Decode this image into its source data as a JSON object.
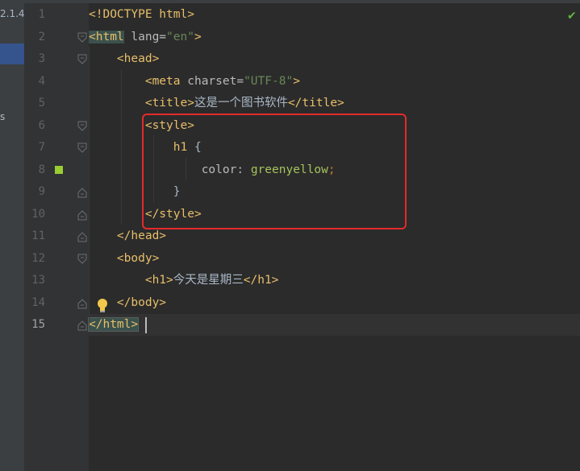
{
  "sidebar": {
    "version_text": "2.1.4",
    "mark_text": "s"
  },
  "gutter": {
    "line_numbers": [
      "1",
      "2",
      "3",
      "4",
      "5",
      "6",
      "7",
      "8",
      "9",
      "10",
      "11",
      "12",
      "13",
      "14",
      "15"
    ]
  },
  "code": {
    "lines": [
      [
        {
          "t": "<!DOCTYPE html>",
          "c": "tag"
        }
      ],
      [
        {
          "t": "<html",
          "c": "tag hl"
        },
        {
          "t": " lang=",
          "c": "attr"
        },
        {
          "t": "\"en\"",
          "c": "str"
        },
        {
          "t": ">",
          "c": "tag"
        }
      ],
      [
        {
          "t": "    <head>",
          "c": "tag"
        }
      ],
      [
        {
          "t": "        <meta",
          "c": "tag"
        },
        {
          "t": " charset=",
          "c": "attr"
        },
        {
          "t": "\"UTF-8\"",
          "c": "str"
        },
        {
          "t": ">",
          "c": "tag"
        }
      ],
      [
        {
          "t": "        <title>",
          "c": "tag"
        },
        {
          "t": "这是一个图书软件",
          "c": "txt"
        },
        {
          "t": "</title>",
          "c": "tag"
        }
      ],
      [
        {
          "t": "        <style>",
          "c": "tag"
        }
      ],
      [
        {
          "t": "            ",
          "c": "plain"
        },
        {
          "t": "h1",
          "c": "sel-name"
        },
        {
          "t": " {",
          "c": "plain"
        }
      ],
      [
        {
          "t": "                ",
          "c": "plain"
        },
        {
          "t": "color",
          "c": "prop"
        },
        {
          "t": ": ",
          "c": "plain"
        },
        {
          "t": "greenyellow",
          "c": "val"
        },
        {
          "t": ";",
          "c": "punct"
        }
      ],
      [
        {
          "t": "            }",
          "c": "plain"
        }
      ],
      [
        {
          "t": "        </style>",
          "c": "tag"
        }
      ],
      [
        {
          "t": "    </head>",
          "c": "tag"
        }
      ],
      [
        {
          "t": "    <body>",
          "c": "tag"
        }
      ],
      [
        {
          "t": "        <h1>",
          "c": "tag"
        },
        {
          "t": "今天是星期三",
          "c": "txt"
        },
        {
          "t": "</h1>",
          "c": "tag"
        }
      ],
      [
        {
          "t": "    </body>",
          "c": "tag"
        }
      ],
      [
        {
          "t": "</html>",
          "c": "tag cursor-tag"
        }
      ]
    ]
  },
  "colors": {
    "background": "#2b2b2b",
    "tag": "#e8bf6a",
    "string": "#6a8759",
    "highlight_box": "#e62a2a",
    "color_marker": "#9acd32"
  },
  "icons": {
    "bulb": "lightbulb-icon",
    "check": "check-icon",
    "fold": "fold-marker-icon"
  },
  "status": {
    "check_glyph": "✔"
  }
}
